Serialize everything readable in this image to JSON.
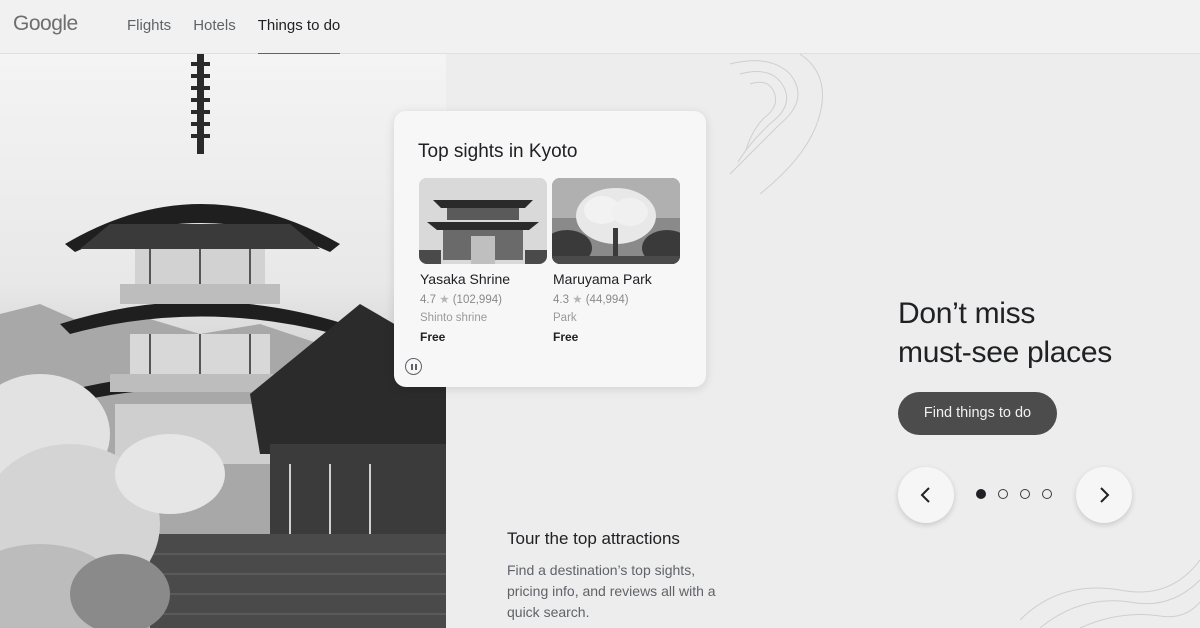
{
  "header": {
    "logo": "Google",
    "nav": [
      {
        "label": "Flights"
      },
      {
        "label": "Hotels"
      },
      {
        "label": "Things to do",
        "active": true
      }
    ]
  },
  "card": {
    "title": "Top sights in Kyoto",
    "sights": [
      {
        "name": "Yasaka Shrine",
        "rating": "4.7",
        "star": "★",
        "reviews": "(102,994)",
        "type": "Shinto shrine",
        "price": "Free"
      },
      {
        "name": "Maruyama Park",
        "rating": "4.3",
        "star": "★",
        "reviews": "(44,994)",
        "type": "Park",
        "price": "Free"
      }
    ]
  },
  "tour": {
    "title": "Tour the top attractions",
    "description": "Find a destination’s top sights, pricing info, and reviews all with a quick search."
  },
  "promo": {
    "title_line1": "Don’t miss",
    "title_line2": "must-see places",
    "cta_label": "Find things to do"
  },
  "carousel": {
    "total": 4,
    "active_index": 0
  },
  "icons": {
    "prev": "chevron-left-icon",
    "next": "chevron-right-icon",
    "pause": "pause-icon"
  }
}
